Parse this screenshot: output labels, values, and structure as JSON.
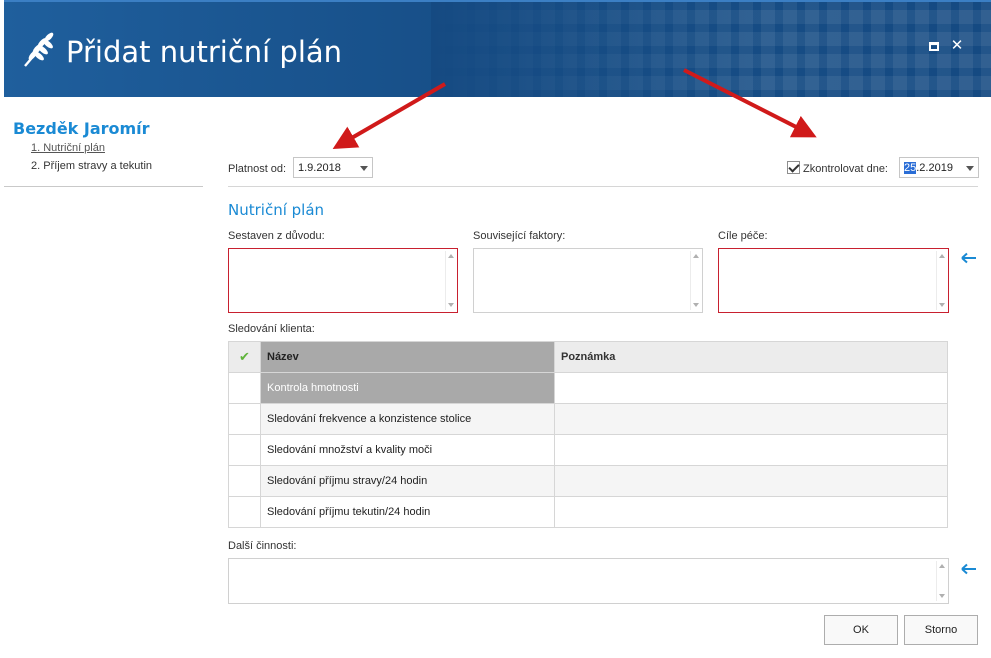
{
  "window": {
    "title": "Přidat nutriční plán"
  },
  "nav": {
    "patient_name": "Bezděk Jaromír",
    "items": [
      {
        "label": "1. Nutriční plán"
      },
      {
        "label": "2. Příjem stravy a tekutin"
      }
    ]
  },
  "form": {
    "valid_from_label": "Platnost od:",
    "valid_from_value": "1.9.2018",
    "check_label": "Zkontrolovat dne:",
    "check_date_day": "25",
    "check_date_rest": ".2.2019",
    "section_title": "Nutriční plán",
    "reason_label": "Sestaven z důvodu:",
    "factors_label": "Související faktory:",
    "goals_label": "Cíle péče:",
    "monitoring_label": "Sledování klienta:",
    "other_label": "Další činnosti:"
  },
  "table": {
    "columns": [
      "Název",
      "Poznámka"
    ],
    "rows": [
      {
        "name": "Kontrola hmotnosti",
        "note": ""
      },
      {
        "name": "Sledování frekvence a konzistence stolice",
        "note": ""
      },
      {
        "name": "Sledování množství a kvality moči",
        "note": ""
      },
      {
        "name": "Sledování příjmu stravy/24 hodin",
        "note": ""
      },
      {
        "name": "Sledování příjmu tekutin/24 hodin",
        "note": ""
      }
    ]
  },
  "buttons": {
    "ok": "OK",
    "cancel": "Storno"
  },
  "colors": {
    "header": "#174f88",
    "accent": "#1a8ad4",
    "required_border": "#c8202f",
    "annotation_arrow": "#d01a1a"
  }
}
